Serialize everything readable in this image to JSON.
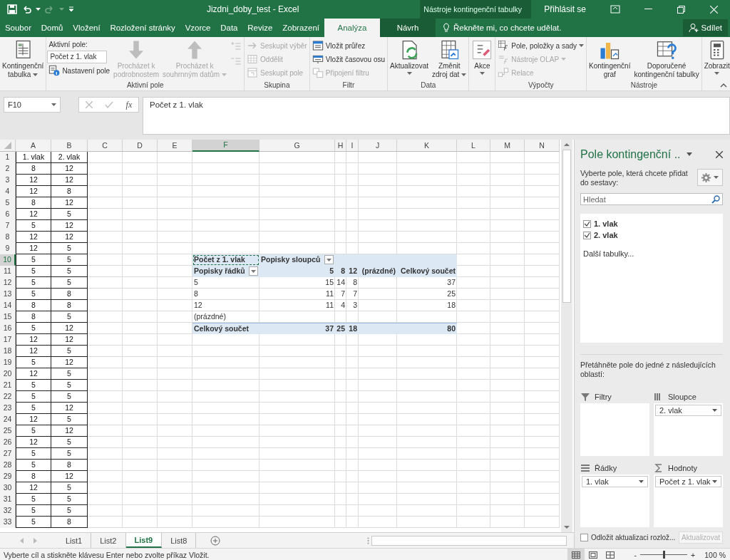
{
  "title_bar": {
    "title": "Jizdni_doby_test - Excel",
    "context_label": "Nástroje kontingenční tabulky",
    "sign_in": "Přihlásit se"
  },
  "tabs": [
    {
      "label": "Soubor",
      "selected": false,
      "kind": "normal"
    },
    {
      "label": "Domů",
      "selected": false,
      "kind": "normal"
    },
    {
      "label": "Vložení",
      "selected": false,
      "kind": "normal"
    },
    {
      "label": "Rozložení stránky",
      "selected": false,
      "kind": "normal"
    },
    {
      "label": "Vzorce",
      "selected": false,
      "kind": "normal"
    },
    {
      "label": "Data",
      "selected": false,
      "kind": "normal"
    },
    {
      "label": "Revize",
      "selected": false,
      "kind": "normal"
    },
    {
      "label": "Zobrazení",
      "selected": false,
      "kind": "normal"
    },
    {
      "label": "Analýza",
      "selected": true,
      "kind": "context"
    },
    {
      "label": "Návrh",
      "selected": false,
      "kind": "context"
    }
  ],
  "tell_me": "Řekněte mi, co chcete udělat.",
  "share": "Sdílet",
  "ribbon": [
    {
      "columns": [
        {
          "kind": "large",
          "label": "Kontingenční\ntabulka",
          "caret": true,
          "disabled": false
        }
      ]
    },
    {
      "label": "Aktivní pole",
      "columns": [
        {
          "kind": "stack",
          "items": [
            {
              "kind": "caption",
              "label": "Aktivní pole:"
            },
            {
              "kind": "field",
              "value": "Počet z 1. vlak"
            },
            {
              "kind": "small",
              "label": "Nastavení pole",
              "caret": false,
              "disabled": false
            }
          ]
        },
        {
          "kind": "large",
          "label": "Procházet k\npodrobnostem",
          "caret": false,
          "disabled": true
        },
        {
          "kind": "large",
          "label": "Procházet k\nsouhrnným datům",
          "caret": true,
          "disabled": true
        },
        {
          "kind": "stack",
          "items": [
            {
              "kind": "icon",
              "disabled": true
            },
            {
              "kind": "icon",
              "disabled": true
            }
          ]
        }
      ]
    },
    {
      "label": "Skupina",
      "columns": [
        {
          "kind": "stack",
          "items": [
            {
              "kind": "small",
              "label": "Seskupit výběr",
              "caret": false,
              "disabled": true
            },
            {
              "kind": "small",
              "label": "Oddělit",
              "caret": false,
              "disabled": true
            },
            {
              "kind": "small",
              "label": "Seskupit pole",
              "caret": false,
              "disabled": true
            }
          ]
        }
      ]
    },
    {
      "label": "Filtr",
      "columns": [
        {
          "kind": "stack",
          "items": [
            {
              "kind": "small",
              "label": "Vložit průřez",
              "caret": false,
              "disabled": false
            },
            {
              "kind": "small",
              "label": "Vložit časovou osu",
              "caret": false,
              "disabled": false
            },
            {
              "kind": "small",
              "label": "Připojení filtru",
              "caret": false,
              "disabled": true
            }
          ]
        }
      ]
    },
    {
      "label": "Data",
      "columns": [
        {
          "kind": "large",
          "label": "Aktualizovat",
          "caret": true,
          "disabled": false
        },
        {
          "kind": "large",
          "label": "Změnit\nzdroj dat",
          "caret": true,
          "disabled": false
        }
      ]
    },
    {
      "columns": [
        {
          "kind": "large",
          "label": "Akce",
          "caret": true,
          "disabled": false
        }
      ]
    },
    {
      "label": "Výpočty",
      "columns": [
        {
          "kind": "stack",
          "items": [
            {
              "kind": "small",
              "label": "Pole, položky a sady",
              "caret": true,
              "disabled": false
            },
            {
              "kind": "small",
              "label": "Nástroje OLAP",
              "caret": true,
              "disabled": true
            },
            {
              "kind": "small",
              "label": "Relace",
              "caret": false,
              "disabled": true
            }
          ]
        }
      ]
    },
    {
      "label": "Nástroje",
      "columns": [
        {
          "kind": "large",
          "label": "Kontingenční\ngraf",
          "caret": false,
          "disabled": false
        },
        {
          "kind": "large",
          "label": "Doporučené\nkontingenční tabulky",
          "caret": false,
          "disabled": false
        }
      ]
    },
    {
      "columns": [
        {
          "kind": "large",
          "label": "Zobrazit",
          "caret": true,
          "disabled": false
        }
      ]
    }
  ],
  "formula_bar": {
    "name_box": "F10",
    "insert_function": "fx",
    "formula": "Počet z 1. vlak"
  },
  "sheet": {
    "columns": [
      {
        "label": "A",
        "selected": false
      },
      {
        "label": "B",
        "selected": false
      },
      {
        "label": "C",
        "selected": false
      },
      {
        "label": "D",
        "selected": false
      },
      {
        "label": "E",
        "selected": false
      },
      {
        "label": "F",
        "selected": true
      },
      {
        "label": "G",
        "selected": false
      },
      {
        "label": "H",
        "selected": false
      },
      {
        "label": "I",
        "selected": false
      },
      {
        "label": "J",
        "selected": false
      },
      {
        "label": "K",
        "selected": false
      },
      {
        "label": "L",
        "selected": false
      },
      {
        "label": "M",
        "selected": false
      },
      {
        "label": "N",
        "selected": false
      }
    ],
    "rows": [
      {
        "label": "1",
        "selected": false,
        "a": "1. vlak",
        "b": "2. vlak"
      },
      {
        "label": "2",
        "selected": false,
        "a": "8",
        "b": "12"
      },
      {
        "label": "3",
        "selected": false,
        "a": "12",
        "b": "12"
      },
      {
        "label": "4",
        "selected": false,
        "a": "12",
        "b": "8"
      },
      {
        "label": "5",
        "selected": false,
        "a": "8",
        "b": "12"
      },
      {
        "label": "6",
        "selected": false,
        "a": "12",
        "b": "5"
      },
      {
        "label": "7",
        "selected": false,
        "a": "5",
        "b": "12"
      },
      {
        "label": "8",
        "selected": false,
        "a": "12",
        "b": "12"
      },
      {
        "label": "9",
        "selected": false,
        "a": "12",
        "b": "5"
      },
      {
        "label": "10",
        "selected": true,
        "a": "5",
        "b": "5"
      },
      {
        "label": "11",
        "selected": false,
        "a": "5",
        "b": "5"
      },
      {
        "label": "12",
        "selected": false,
        "a": "5",
        "b": "5"
      },
      {
        "label": "13",
        "selected": false,
        "a": "5",
        "b": "8"
      },
      {
        "label": "14",
        "selected": false,
        "a": "8",
        "b": "8"
      },
      {
        "label": "15",
        "selected": false,
        "a": "8",
        "b": "5"
      },
      {
        "label": "16",
        "selected": false,
        "a": "5",
        "b": "12"
      },
      {
        "label": "17",
        "selected": false,
        "a": "12",
        "b": "12"
      },
      {
        "label": "18",
        "selected": false,
        "a": "12",
        "b": "5"
      },
      {
        "label": "19",
        "selected": false,
        "a": "5",
        "b": "12"
      },
      {
        "label": "20",
        "selected": false,
        "a": "12",
        "b": "5"
      },
      {
        "label": "21",
        "selected": false,
        "a": "5",
        "b": "5"
      },
      {
        "label": "22",
        "selected": false,
        "a": "5",
        "b": "5"
      },
      {
        "label": "23",
        "selected": false,
        "a": "5",
        "b": "12"
      },
      {
        "label": "24",
        "selected": false,
        "a": "12",
        "b": "5"
      },
      {
        "label": "25",
        "selected": false,
        "a": "5",
        "b": "12"
      },
      {
        "label": "26",
        "selected": false,
        "a": "12",
        "b": "5"
      },
      {
        "label": "27",
        "selected": false,
        "a": "5",
        "b": "5"
      },
      {
        "label": "28",
        "selected": false,
        "a": "5",
        "b": "8"
      },
      {
        "label": "29",
        "selected": false,
        "a": "8",
        "b": "12"
      },
      {
        "label": "30",
        "selected": false,
        "a": "12",
        "b": "5"
      },
      {
        "label": "31",
        "selected": false,
        "a": "5",
        "b": "5"
      },
      {
        "label": "32",
        "selected": false,
        "a": "5",
        "b": "5"
      },
      {
        "label": "33",
        "selected": false,
        "a": "5",
        "b": "8"
      }
    ]
  },
  "pivot": {
    "value_field": "Počet z 1. vlak",
    "column_labels": "Popisky sloupců",
    "row_labels": "Popisky řádků",
    "columns": [
      "5",
      "8",
      "12",
      "(prázdné)",
      "Celkový součet"
    ],
    "rows": [
      {
        "label": "5",
        "values": [
          "15",
          "14",
          "8"
        ],
        "total": "37"
      },
      {
        "label": "8",
        "values": [
          "11",
          "7",
          "7"
        ],
        "total": "25"
      },
      {
        "label": "12",
        "values": [
          "11",
          "4",
          "3"
        ],
        "total": "18"
      },
      {
        "label": "(prázdné)"
      }
    ],
    "total": {
      "label": "Celkový součet",
      "values": [
        "37",
        "25",
        "18"
      ],
      "total": "80"
    }
  },
  "sheet_tabs": [
    {
      "label": "List1",
      "selected": false
    },
    {
      "label": "List2",
      "selected": false
    },
    {
      "label": "List9",
      "selected": true
    },
    {
      "label": "List8",
      "selected": false
    }
  ],
  "field_pane": {
    "title": "Pole kontingenční ..",
    "instruction": "Vyberte pole, která chcete přidat do sestavy:",
    "search": {
      "placeholder": "Hledat"
    },
    "fields": [
      {
        "label": "1. vlak",
        "checked": true
      },
      {
        "label": "2. vlak",
        "checked": true
      }
    ],
    "more_tables": "Další tabulky...",
    "drag_hint": "Přetáhněte pole do jedné z následujících oblastí:",
    "areas": [
      {
        "label": "Filtry"
      },
      {
        "label": "Sloupce",
        "items": [
          "2. vlak"
        ]
      },
      {
        "label": "Řádky",
        "items": [
          "1. vlak"
        ]
      },
      {
        "label": "Hodnoty",
        "items": [
          "Počet z 1. vlak"
        ]
      }
    ],
    "defer": {
      "label": "Odložit aktualizaci rozlož...",
      "checked": false
    },
    "update": {
      "label": "Aktualizovat",
      "disabled": true
    }
  },
  "status_bar": {
    "message": "Vyberte cíl a stiskněte klávesu Enter nebo zvolte příkaz Vložit.",
    "zoom": {
      "out": "-",
      "in": "+",
      "level": 0.5,
      "reading": "100 %"
    }
  }
}
